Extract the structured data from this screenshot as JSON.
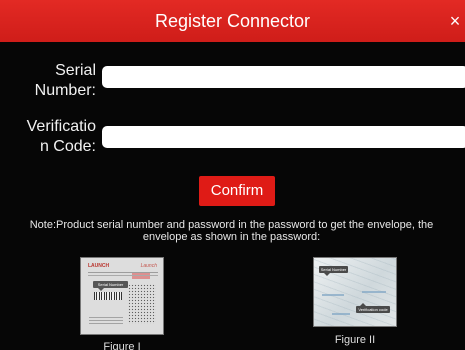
{
  "dialog": {
    "title": "Register Connector",
    "close_symbol": "×",
    "fields": {
      "serial_number": {
        "label": "Serial\nNumber:",
        "value": "",
        "placeholder": ""
      },
      "verification_code": {
        "label": "Verificatio\nn Code:",
        "value": "",
        "placeholder": ""
      }
    },
    "confirm_label": "Confirm",
    "note": "Note:Product serial number and password in the password to get the envelope, the envelope as shown in the password:",
    "figures": [
      {
        "caption": "Figure I",
        "callout": "Serial Number"
      },
      {
        "caption": "Figure II",
        "callout_serial": "Serial Number",
        "callout_verification": "Verification code"
      }
    ]
  },
  "colors": {
    "title_bar": "#df1f1a",
    "confirm_button": "#df1b16",
    "background": "#060606",
    "text": "#f1f1f1"
  },
  "icons": {
    "close": "close-icon"
  }
}
